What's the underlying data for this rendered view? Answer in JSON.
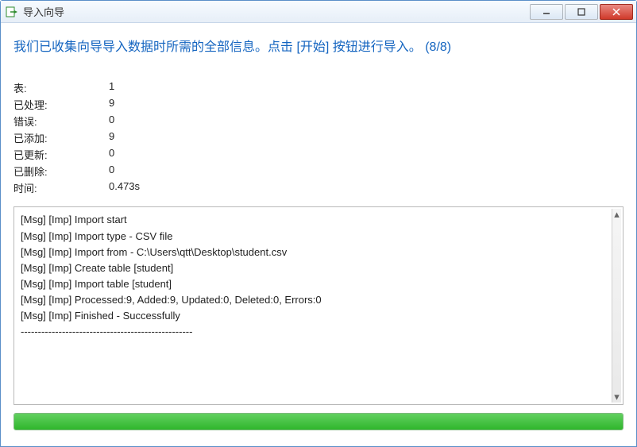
{
  "window": {
    "title": "导入向导"
  },
  "headline": "我们已收集向导导入数据时所需的全部信息。点击 [开始] 按钮进行导入。  (8/8)",
  "stats": {
    "tables_label": "表:",
    "tables_value": "1",
    "processed_label": "已处理:",
    "processed_value": "9",
    "errors_label": "错误:",
    "errors_value": "0",
    "added_label": "已添加:",
    "added_value": "9",
    "updated_label": "已更新:",
    "updated_value": "0",
    "deleted_label": "已删除:",
    "deleted_value": "0",
    "time_label": "时间:",
    "time_value": "0.473s"
  },
  "log": {
    "lines": [
      "[Msg] [Imp] Import start",
      "[Msg] [Imp] Import type - CSV file",
      "[Msg] [Imp] Import from - C:\\Users\\qtt\\Desktop\\student.csv",
      "[Msg] [Imp] Create table [student]",
      "[Msg] [Imp] Import table [student]",
      "[Msg] [Imp] Processed:9, Added:9, Updated:0, Deleted:0, Errors:0",
      "[Msg] [Imp] Finished - Successfully",
      "--------------------------------------------------"
    ]
  },
  "progress": {
    "percent": 100
  }
}
